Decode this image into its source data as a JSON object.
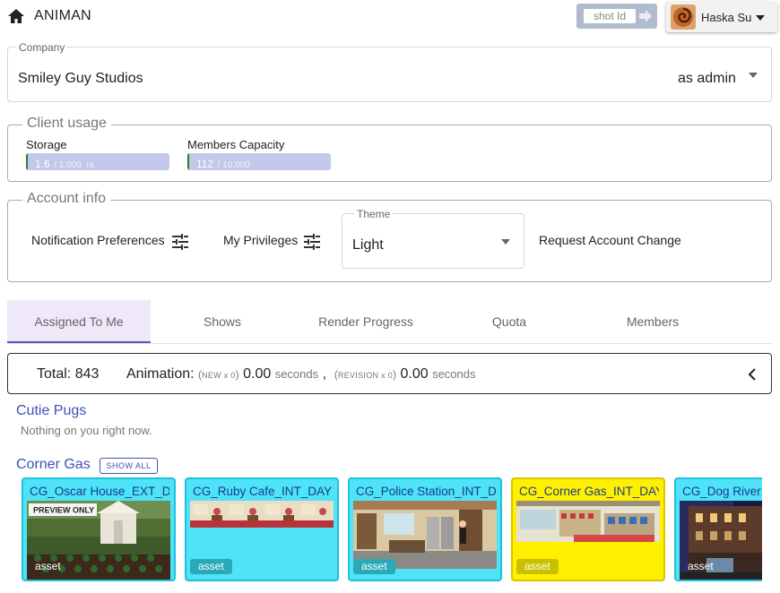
{
  "app": {
    "title": "ANIMAN"
  },
  "header": {
    "shot_placeholder": "shot Id",
    "user_name": "Haska Su"
  },
  "company": {
    "label": "Company",
    "value": "Smiley Guy Studios",
    "role": "as admin"
  },
  "client_usage": {
    "legend": "Client usage",
    "storage": {
      "label": "Storage",
      "value": "1.6",
      "total": "/ 1,000",
      "unit": "TB",
      "fraction": 0.0016
    },
    "members": {
      "label": "Members Capacity",
      "value": "112",
      "total": "/ 10,000",
      "fraction": 0.0112
    }
  },
  "account_info": {
    "legend": "Account info",
    "notification_label": "Notification Preferences",
    "privileges_label": "My Privileges",
    "theme_label": "Theme",
    "theme_value": "Light",
    "request_change_label": "Request Account Change"
  },
  "tabs": [
    {
      "label": "Assigned To Me",
      "active": true
    },
    {
      "label": "Shows",
      "active": false
    },
    {
      "label": "Render Progress",
      "active": false
    },
    {
      "label": "Quota",
      "active": false
    },
    {
      "label": "Members",
      "active": false
    }
  ],
  "summary": {
    "total_label": "Total:",
    "total_value": "843",
    "animation_label": "Animation:",
    "new_label": "NEW x 0",
    "new_seconds": "0.00",
    "revision_label": "REVISION x 0",
    "revision_seconds": "0.00",
    "seconds_unit": "seconds"
  },
  "projects": [
    {
      "title": "Cutie Pugs",
      "empty_message": "Nothing on you right now."
    },
    {
      "title": "Corner Gas",
      "show_all_label": "SHOW ALL",
      "cards": [
        {
          "title": "CG_Oscar House_EXT_DAY",
          "badge": "asset",
          "preview_label": "PREVIEW ONLY",
          "color": "#4fe3f7"
        },
        {
          "title": "CG_Ruby Cafe_INT_DAY",
          "badge": "asset",
          "color": "#4fe3f7"
        },
        {
          "title": "CG_Police Station_INT_DAY",
          "badge": "asset",
          "color": "#4fe3f7"
        },
        {
          "title": "CG_Corner Gas_INT_DAY",
          "badge": "asset",
          "color": "#fff000"
        },
        {
          "title": "CG_Dog River",
          "badge": "asset",
          "color": "#4fe3f7"
        }
      ]
    }
  ],
  "colors": {
    "accent": "#3f51b5",
    "tab_active_bg": "#efe8f9",
    "usage_bar": "#c3c8ea"
  }
}
